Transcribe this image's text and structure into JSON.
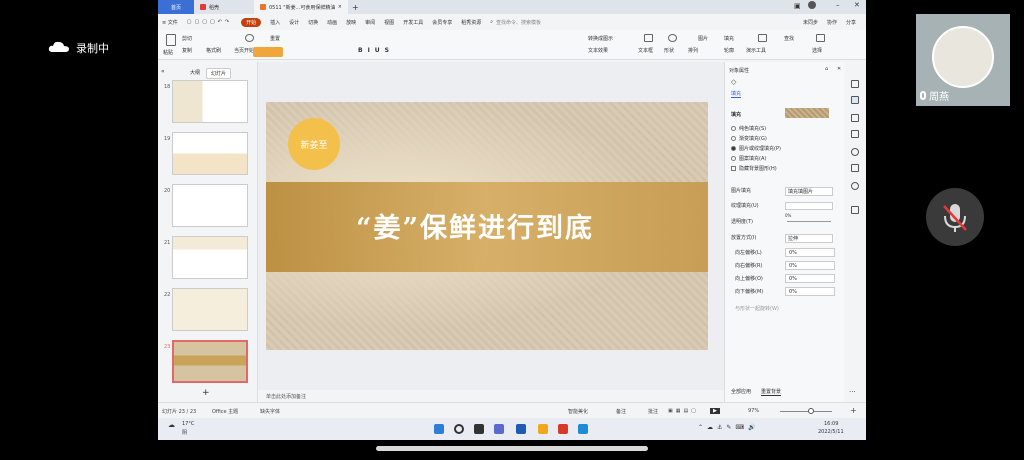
{
  "outer": {
    "brand": "录制中",
    "user_name": "周燕"
  },
  "tabs": [
    {
      "label": "首页"
    },
    {
      "label": "稻壳"
    },
    {
      "label": "0511 \"新姜...可食用保鲜精油"
    }
  ],
  "menu": {
    "file": "≡ 文件",
    "items": [
      "开始",
      "插入",
      "设计",
      "切换",
      "动画",
      "放映",
      "审阅",
      "视图",
      "开发工具",
      "会员专享",
      "稻秀资源"
    ],
    "search_placeholder": "查找命令、搜索模板",
    "right_items": [
      "未同步",
      "协作",
      "分享"
    ]
  },
  "ribbon": {
    "paste": "粘贴",
    "cut": "剪切",
    "copy": "复制",
    "format_painter": "格式刷",
    "play": "当页开始",
    "reset": "重置",
    "textbox": "文本框",
    "shape": "形状",
    "arrange": "排列",
    "picture": "图片",
    "fill": "填充",
    "outline": "轮廓",
    "find": "查找",
    "select": "选择",
    "presentation_tools": "演示工具",
    "convert_smart": "转换成图示",
    "text_effect": "文本效果"
  },
  "left_panel": {
    "tab_outline": "大纲",
    "tab_slides": "幻灯片",
    "thumb_numbers": [
      "18",
      "19",
      "20",
      "21",
      "22",
      "23"
    ]
  },
  "slide": {
    "logo_text": "新姜至",
    "title": "“姜”保鲜进行到底"
  },
  "notes": {
    "placeholder": "单击此处添加备注"
  },
  "right_pane": {
    "title": "对象属性",
    "section": "填充",
    "fill_label": "填充",
    "fill_options": [
      {
        "label": "纯色填充(S)",
        "selected": false
      },
      {
        "label": "渐变填充(G)",
        "selected": false
      },
      {
        "label": "图片或纹理填充(P)",
        "selected": true
      },
      {
        "label": "图案填充(A)",
        "selected": false
      },
      {
        "label": "隐藏背景图形(H)",
        "selected": false
      }
    ],
    "picture_fill_label": "图片填充",
    "picture_fill_value": "填充填图片",
    "texture_label": "纹理填充(U)",
    "transparency_label": "透明度(T)",
    "transparency_value": "0%",
    "stretch_label": "放置方式(I)",
    "stretch_value": "拉伸",
    "offsets": [
      {
        "label": "向左偏移(L)",
        "value": "0%"
      },
      {
        "label": "向右偏移(R)",
        "value": "0%"
      },
      {
        "label": "向上偏移(O)",
        "value": "0%"
      },
      {
        "label": "向下偏移(M)",
        "value": "0%"
      }
    ],
    "rotate_with_shape": "与形状一起旋转(W)",
    "apply_all": "全部应用",
    "reset_background": "重置背景"
  },
  "status": {
    "slide_count": "幻灯片 23 / 23",
    "theme": "Office 主题",
    "missing_font": "缺失字体",
    "smart_beautify": "智能美化",
    "notes": "备注",
    "comment": "批注",
    "zoom": "97%"
  },
  "taskbar": {
    "weather_temp": "17°C",
    "weather_desc": "阴",
    "time": "16:09",
    "date": "2022/5/11"
  }
}
